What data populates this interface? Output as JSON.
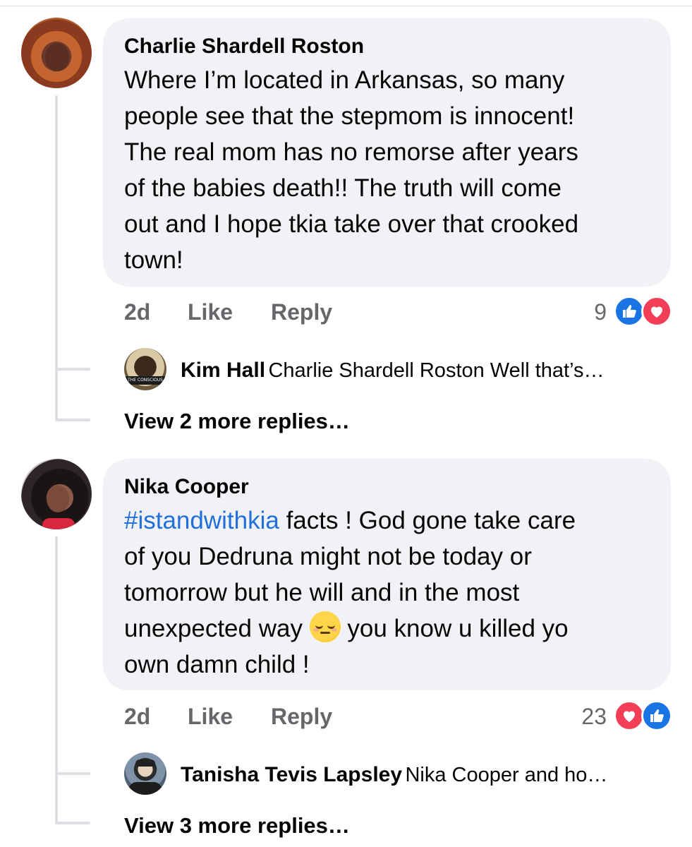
{
  "comments": [
    {
      "author": "Charlie Shardell Roston",
      "lines": [
        "Where I’m located in Arkansas, so many",
        "people see that the stepmom is innocent!",
        "The real mom has no remorse after years",
        "of the babies death!! The truth will come",
        "out and I hope tkia take over that crooked",
        "town!"
      ],
      "time": "2d",
      "like_label": "Like",
      "reply_label": "Reply",
      "reaction_count": "9",
      "reactions": [
        "like-icon",
        "love-icon"
      ],
      "reply_preview": {
        "name": "Kim Hall",
        "text": "Charlie Shardell Roston Well that’s…",
        "avatar_text": "THE CONSCIOUS"
      },
      "view_more": "View 2 more replies…"
    },
    {
      "author": "Nika Cooper",
      "hashtag": "#istandwithkia",
      "line1_rest": " facts ! God gone take care",
      "lines": [
        "of you Dedruna might not be today or",
        "tomorrow but he will and in the most"
      ],
      "line4_before_emoji": "unexpected way ",
      "emoji": "relieved-face-emoji",
      "line4_after_emoji": " you know u killed yo",
      "line5": "own damn child !",
      "time": "2d",
      "like_label": "Like",
      "reply_label": "Reply",
      "reaction_count": "23",
      "reactions": [
        "love-icon",
        "like-icon"
      ],
      "reply_preview": {
        "name": "Tanisha Tevis Lapsley",
        "text": "Nika Cooper and ho…"
      },
      "view_more": "View 3 more replies…"
    }
  ],
  "colors": {
    "bubble": "#f0f2f5",
    "meta_text": "#65676b",
    "hashtag": "#216fdb",
    "like_blue": "#1b74e4",
    "love_red": "#f33e58"
  }
}
